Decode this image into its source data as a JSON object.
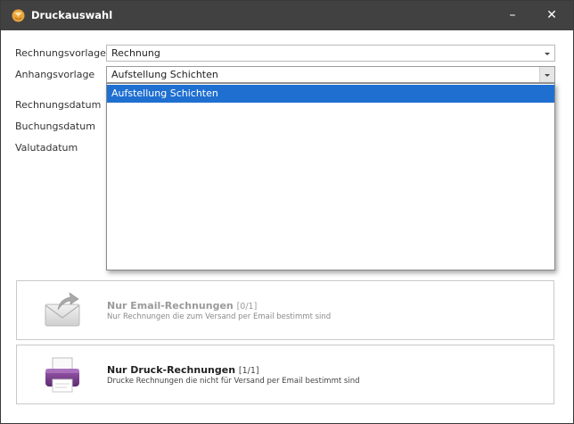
{
  "window": {
    "title": "Druckauswahl",
    "minimize_glyph": "–",
    "close_glyph": "✕"
  },
  "form": {
    "rechnungsvorlage": {
      "label": "Rechnungsvorlage",
      "value": "Rechnung"
    },
    "anhangsvorlage": {
      "label": "Anhangsvorlage",
      "value": "Aufstellung Schichten"
    },
    "rechnungsdatum_label": "Rechnungsdatum",
    "buchungsdatum_label": "Buchungsdatum",
    "valutadatum_label": "Valutadatum"
  },
  "dropdown": {
    "options": [
      "Aufstellung Schichten"
    ],
    "selected_index": 0
  },
  "actions": {
    "email": {
      "title": "Nur Email-Rechnungen",
      "count": "[0/1]",
      "description": "Nur Rechnungen die zum Versand per Email bestimmt sind",
      "enabled": false,
      "icon": "envelope-share-icon"
    },
    "print": {
      "title": "Nur Druck-Rechnungen",
      "count": "[1/1]",
      "description": "Drucke Rechnungen die nicht für Versand per Email bestimmt sind",
      "enabled": true,
      "icon": "printer-icon"
    }
  },
  "colors": {
    "titlebar": "#414141",
    "selection": "#1f6fd1",
    "printer_body": "#7b3f8e"
  }
}
